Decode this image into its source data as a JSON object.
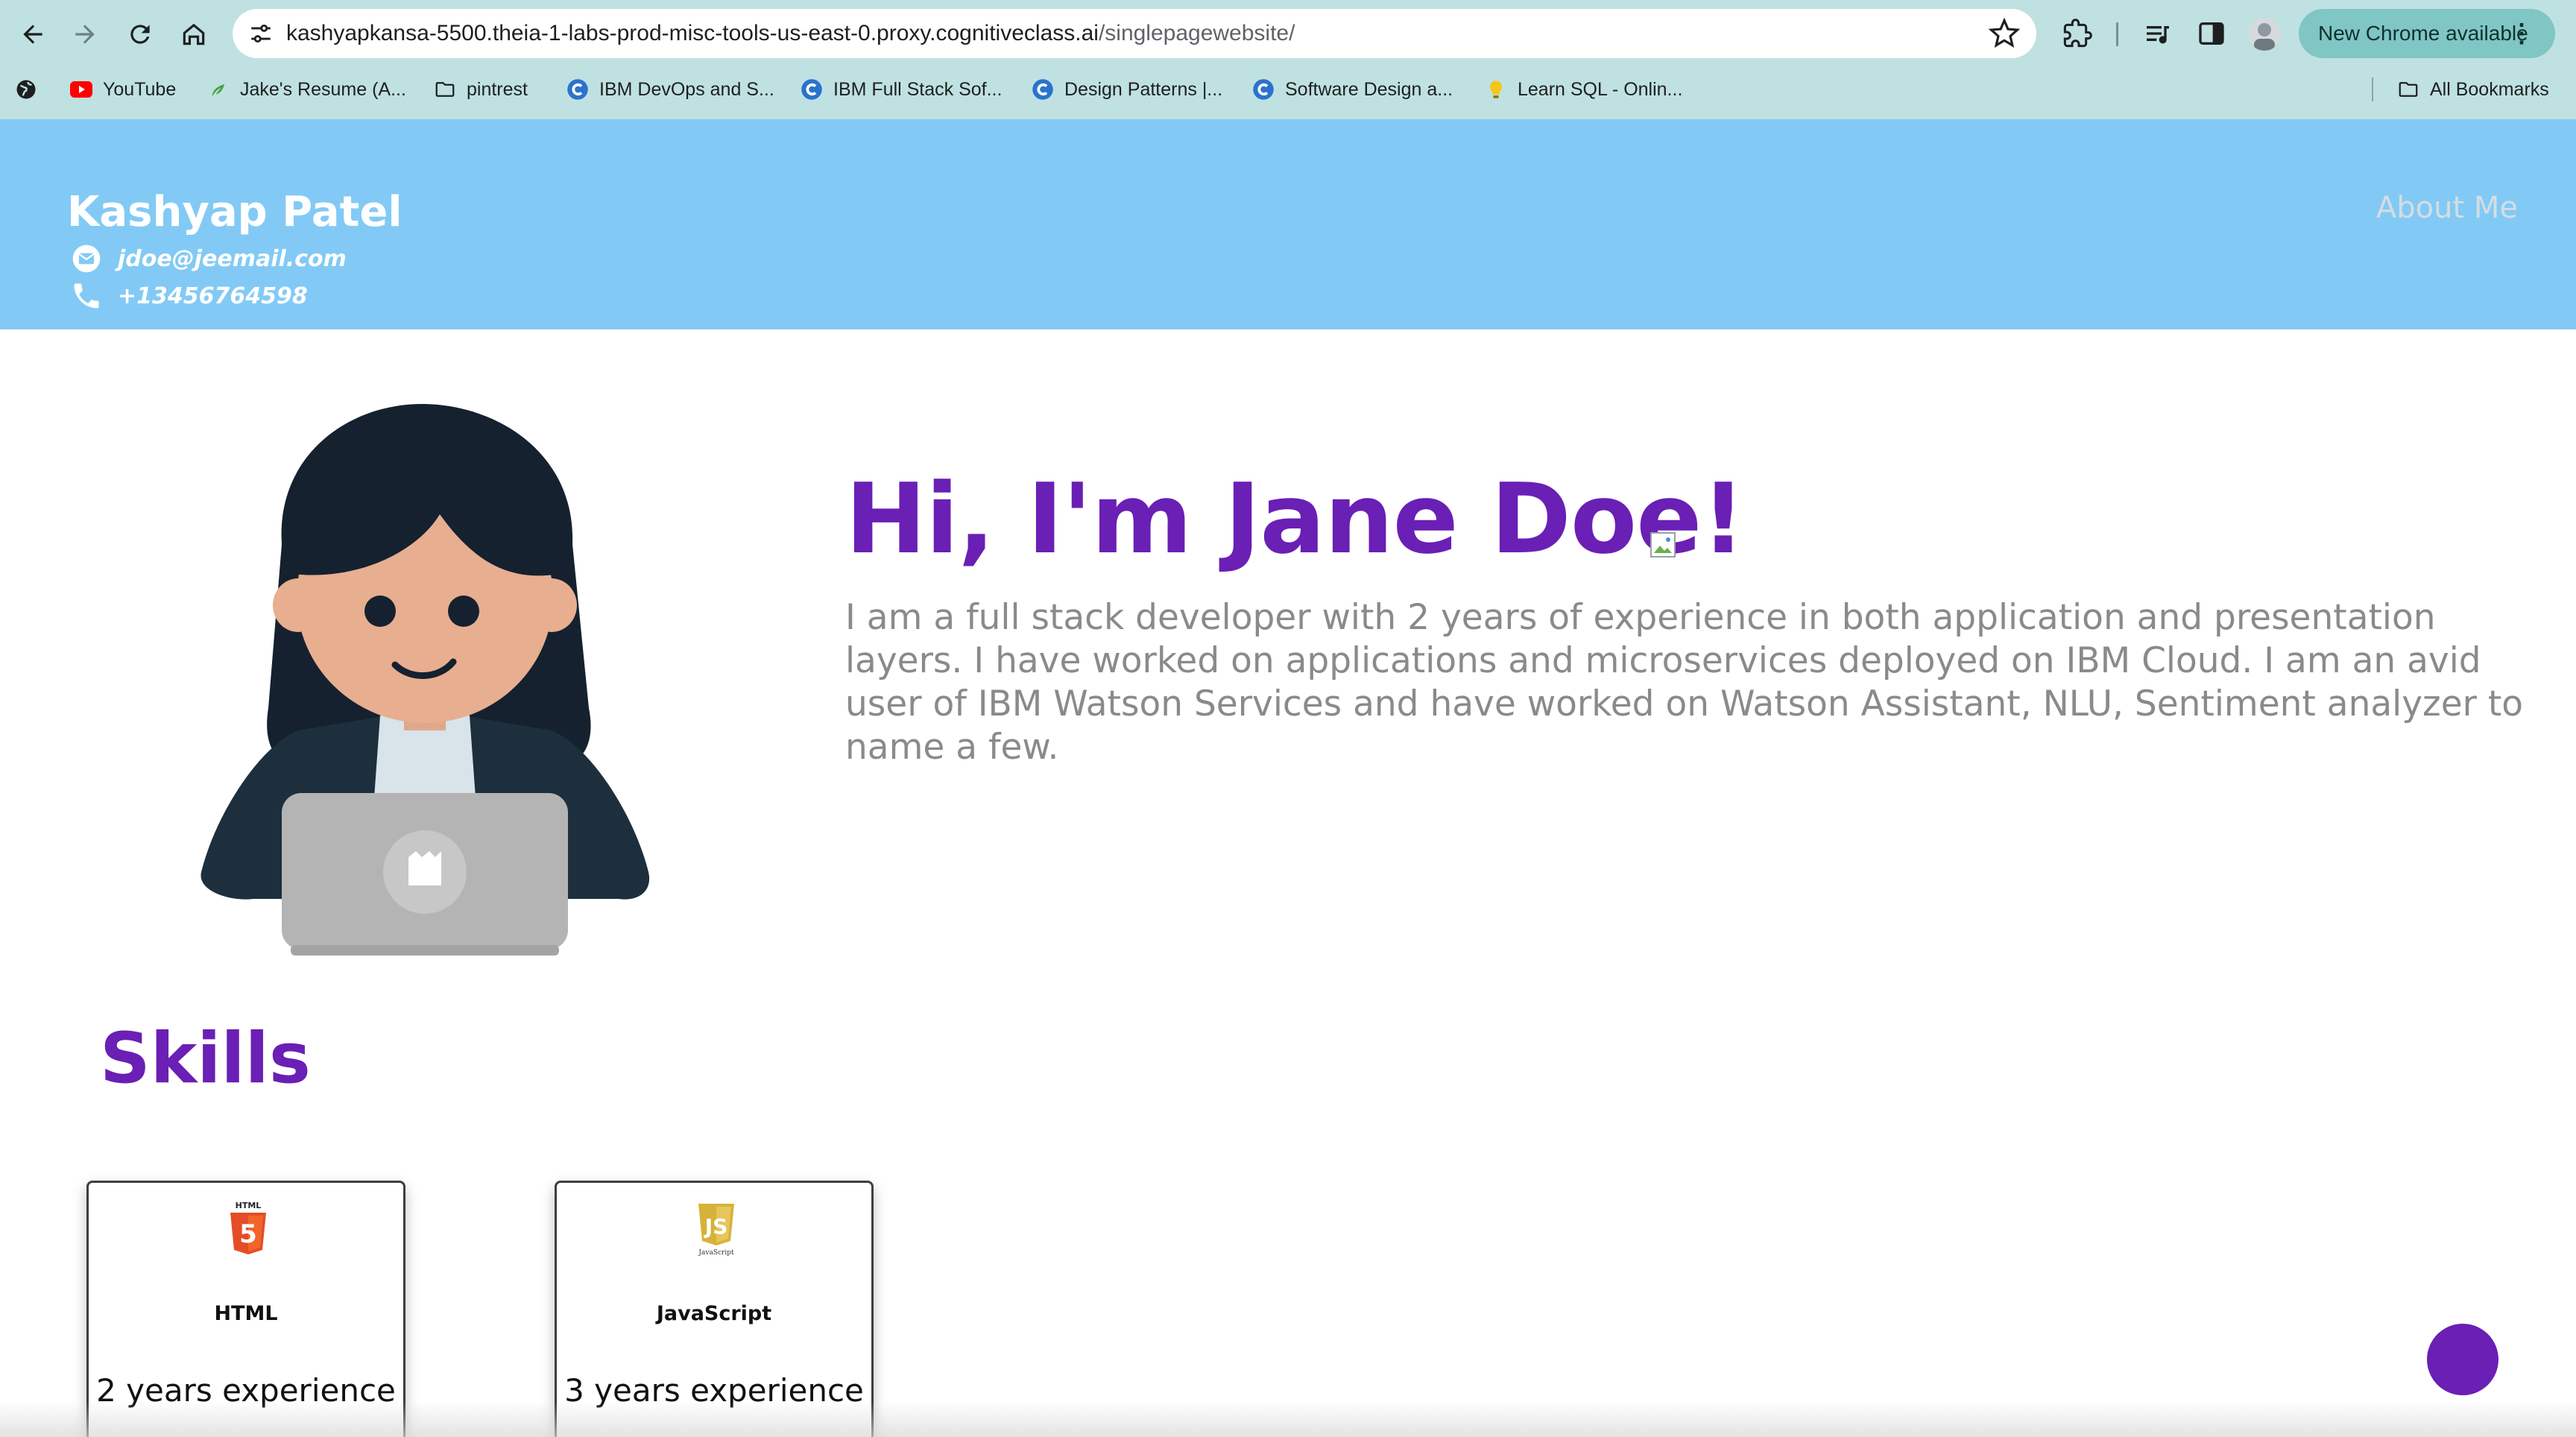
{
  "browser": {
    "url_host": "kashyapkansa-5500.theia-1-labs-prod-misc-tools-us-east-0.proxy.cognitiveclass.ai",
    "url_path": "/singlepagewebsite/",
    "update_label": "New Chrome available",
    "bookmarks": [
      {
        "label": "YouTube",
        "icon": "youtube-icon"
      },
      {
        "label": "Jake's Resume (A...",
        "icon": "overleaf-icon"
      },
      {
        "label": "pintrest",
        "icon": "folder-icon"
      },
      {
        "label": "IBM DevOps and S...",
        "icon": "coursera-icon"
      },
      {
        "label": "IBM Full Stack Sof...",
        "icon": "coursera-icon"
      },
      {
        "label": "Design Patterns |...",
        "icon": "coursera-icon"
      },
      {
        "label": "Software Design a...",
        "icon": "coursera-icon"
      },
      {
        "label": "Learn SQL - Onlin...",
        "icon": "bulb-icon"
      }
    ],
    "all_bookmarks_label": "All Bookmarks"
  },
  "header": {
    "name": "Kashyap Patel",
    "email": "jdoe@jeemail.com",
    "phone": "+13456764598",
    "nav_about": "About Me"
  },
  "hero": {
    "title": "Hi, I'm Jane Doe!",
    "bio": "I am a full stack developer with 2 years of experience in both application and presentation layers. I have worked on applications and microservices deployed on IBM Cloud. I am an avid user of IBM Watson Services and have worked on Watson Assistant, NLU, Sentiment analyzer to name a few."
  },
  "skills": {
    "title": "Skills",
    "items": [
      {
        "name": "HTML",
        "experience": "2 years experience",
        "logo_text": "HTML",
        "logo_number": "5",
        "color": "#e44d26"
      },
      {
        "name": "JavaScript",
        "experience": "3 years experience",
        "logo_text": "JavaScript",
        "logo_number": "JS",
        "color": "#d6b23a"
      }
    ]
  },
  "colors": {
    "header_bg": "#82caf5",
    "accent_purple": "#6a1fb5",
    "browser_chrome": "#bfe1e2"
  }
}
